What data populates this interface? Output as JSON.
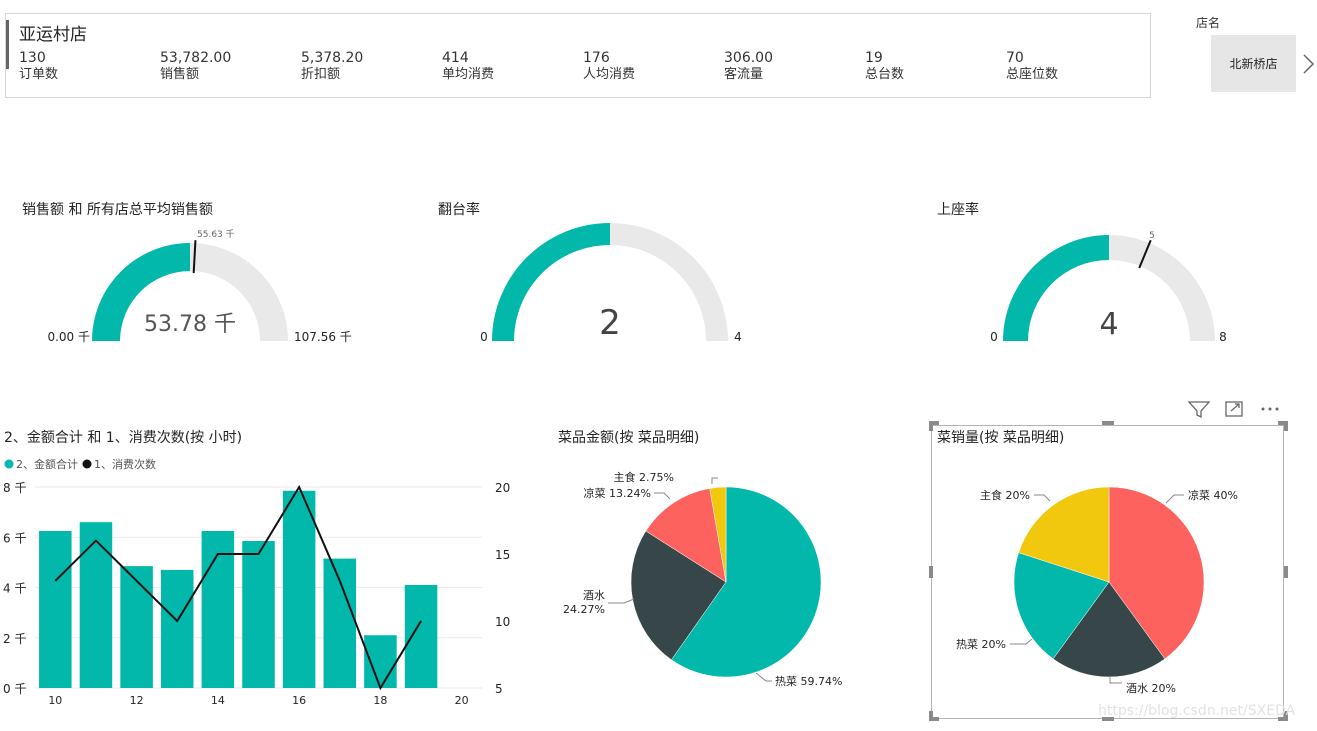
{
  "kpi_card": {
    "store": "亚运村店",
    "items": [
      {
        "value": "130",
        "label": "订单数"
      },
      {
        "value": "53,782.00",
        "label": "销售额"
      },
      {
        "value": "5,378.20",
        "label": "折扣额"
      },
      {
        "value": "414",
        "label": "单均消费"
      },
      {
        "value": "176",
        "label": "人均消费"
      },
      {
        "value": "306.00",
        "label": "客流量"
      },
      {
        "value": "19",
        "label": "总台数"
      },
      {
        "value": "70",
        "label": "总座位数"
      }
    ]
  },
  "slicer": {
    "label": "店名",
    "option": "北新桥店",
    "next_icon": "chevron-right-icon"
  },
  "toolbar": {
    "icons": [
      "filter-icon",
      "focus-mode-icon",
      "more-options-icon"
    ]
  },
  "watermark": "https://blog.csdn.net/SXEDA",
  "colors": {
    "teal": "#01b8aa",
    "dark": "#374649",
    "red": "#fd625e",
    "yellow": "#f2c80f",
    "track": "#e9e9e9"
  },
  "chart_data": [
    {
      "type": "gauge",
      "title": "销售额 和 所有店总平均销售额",
      "min": 0,
      "max": 107.56,
      "value": 53.78,
      "target": 55.63,
      "min_label": "0.00 千",
      "max_label": "107.56 千",
      "value_label": "53.78 千",
      "target_label": "55.63 千"
    },
    {
      "type": "gauge",
      "title": "翻台率",
      "min": 0,
      "max": 4,
      "value": 2,
      "min_label": "0",
      "max_label": "4",
      "value_label": "2"
    },
    {
      "type": "gauge",
      "title": "上座率",
      "min": 0,
      "max": 8,
      "value": 4,
      "target": 5,
      "min_label": "0",
      "max_label": "8",
      "value_label": "4",
      "target_label": "5"
    },
    {
      "type": "combo",
      "title": "2、金额合计 和 1、消费次数(按 小时)",
      "x": [
        10,
        11,
        12,
        13,
        14,
        15,
        16,
        17,
        18,
        19
      ],
      "x_ticks": [
        "10",
        "12",
        "14",
        "16",
        "18",
        "20"
      ],
      "series": [
        {
          "name": "2、金额合计",
          "type": "bar",
          "axis": "left",
          "values": [
            6250,
            6600,
            4850,
            4700,
            6250,
            5850,
            7850,
            5150,
            2100,
            4100
          ]
        },
        {
          "name": "1、消费次数",
          "type": "line",
          "axis": "right",
          "values": [
            13,
            16,
            13,
            10,
            15,
            15,
            20,
            13,
            5,
            10
          ]
        }
      ],
      "y_left": {
        "range": [
          0,
          8000
        ],
        "ticks": [
          "0 千",
          "2 千",
          "4 千",
          "6 千",
          "8 千"
        ]
      },
      "y_right": {
        "range": [
          5,
          20
        ],
        "ticks": [
          "5",
          "10",
          "15",
          "20"
        ]
      },
      "legend": "top-left"
    },
    {
      "type": "pie",
      "title": "菜品金额(按 菜品明细)",
      "slices": [
        {
          "label": "热菜",
          "value": 59.74,
          "pct": "59.74%"
        },
        {
          "label": "酒水",
          "value": 24.27,
          "pct": "24.27%"
        },
        {
          "label": "凉菜",
          "value": 13.24,
          "pct": "13.24%"
        },
        {
          "label": "主食",
          "value": 2.75,
          "pct": "2.75%"
        }
      ]
    },
    {
      "type": "pie",
      "title": "菜销量(按 菜品明细)",
      "slices": [
        {
          "label": "凉菜",
          "value": 40,
          "pct": "40%"
        },
        {
          "label": "酒水",
          "value": 20,
          "pct": "20%"
        },
        {
          "label": "热菜",
          "value": 20,
          "pct": "20%"
        },
        {
          "label": "主食",
          "value": 20,
          "pct": "20%"
        }
      ]
    }
  ]
}
